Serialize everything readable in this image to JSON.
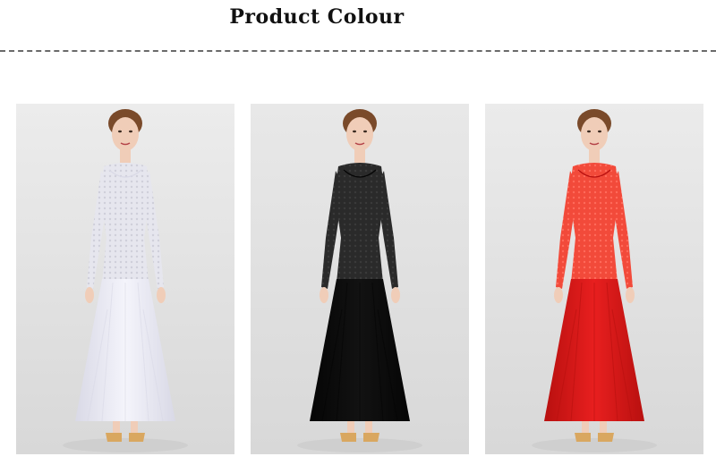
{
  "header": {
    "title": "Product  Colour"
  },
  "colours": [
    {
      "name": "white",
      "dress": "#f4f4fb",
      "lace": "#e6e6ee",
      "shade": "#d9d9e6",
      "backdrop": "#ececec"
    },
    {
      "name": "black",
      "dress": "#121212",
      "lace": "#2a2a2a",
      "shade": "#050505",
      "backdrop": "#e8e8e8"
    },
    {
      "name": "red",
      "dress": "#e81f1f",
      "lace": "#f24a3a",
      "shade": "#b8100f",
      "backdrop": "#ebebeb"
    }
  ]
}
